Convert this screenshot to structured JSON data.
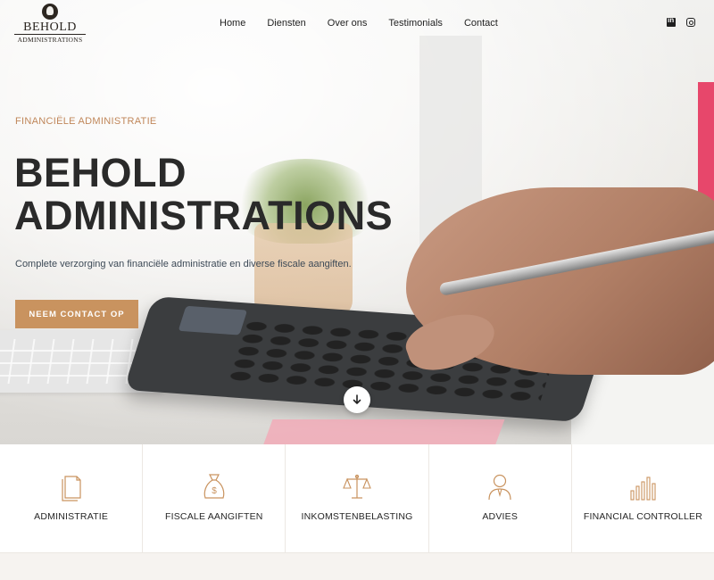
{
  "brand": {
    "name": "BEHOLD",
    "sub": "ADMINISTRATIONS",
    "accent": "#c9935f",
    "icon": "owl-logo-icon"
  },
  "nav": {
    "items": [
      {
        "label": "Home"
      },
      {
        "label": "Diensten"
      },
      {
        "label": "Over ons"
      },
      {
        "label": "Testimonials"
      },
      {
        "label": "Contact"
      }
    ],
    "social": [
      {
        "icon": "linkedin-icon"
      },
      {
        "icon": "instagram-icon"
      }
    ]
  },
  "hero": {
    "eyebrow": "FINANCIËLE ADMINISTRATIE",
    "title_line1": "BEHOLD",
    "title_line2": "ADMINISTRATIONS",
    "subtitle": "Complete verzorging van financiële administratie en diverse fiscale aangiften.",
    "cta_label": "NEEM CONTACT OP",
    "scroll_icon": "arrow-down-icon"
  },
  "services": [
    {
      "label": "ADMINISTRATIE",
      "icon": "documents-icon"
    },
    {
      "label": "FISCALE AANGIFTEN",
      "icon": "money-bag-icon"
    },
    {
      "label": "INKOMSTENBELASTING",
      "icon": "scales-icon"
    },
    {
      "label": "ADVIES",
      "icon": "advisor-icon"
    },
    {
      "label": "FINANCIAL CONTROLLER",
      "icon": "bar-chart-icon"
    }
  ]
}
